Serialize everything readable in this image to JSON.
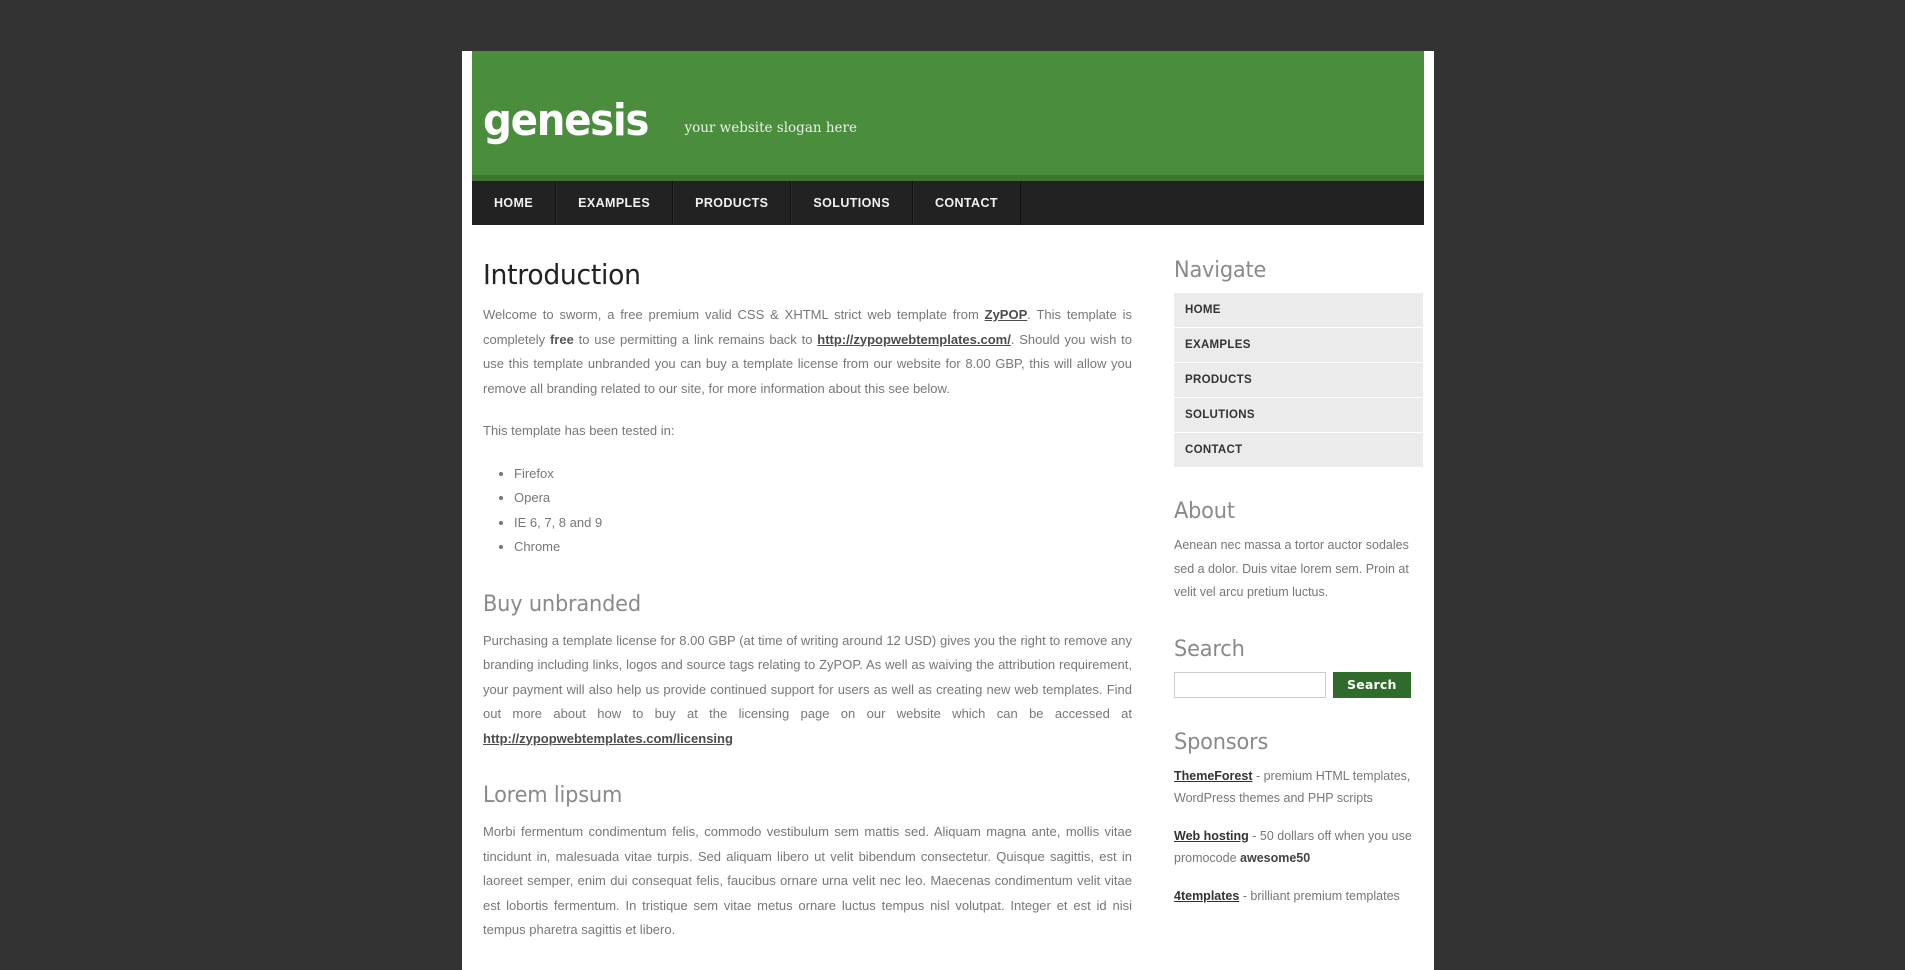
{
  "site": {
    "logo": "genesis",
    "slogan": "your website slogan here"
  },
  "main_nav": [
    {
      "label": "HOME"
    },
    {
      "label": "EXAMPLES"
    },
    {
      "label": "PRODUCTS"
    },
    {
      "label": "SOLUTIONS"
    },
    {
      "label": "CONTACT"
    }
  ],
  "main": {
    "page_title": "Introduction",
    "intro": {
      "part1": "Welcome to sworm, a free premium valid CSS & XHTML strict web template from ",
      "link1": "ZyPOP",
      "part2": ". This template is completely ",
      "bold1": "free",
      "part3": " to use permitting a link remains back to ",
      "link2": "http://zypopwebtemplates.com/",
      "part4": ". Should you wish to use this template unbranded you can buy a template license from our website for 8.00 GBP, this will allow you remove all branding related to our site, for more information about this see below."
    },
    "tested_intro": "This template has been tested in:",
    "browsers": [
      "Firefox",
      "Opera",
      "IE 6, 7, 8 and 9",
      "Chrome"
    ],
    "buy_heading": "Buy unbranded",
    "buy_text": {
      "part1": "Purchasing a template license for 8.00 GBP (at time of writing around 12 USD) gives you the right to remove any branding including links, logos and source tags relating to ZyPOP. As well as waiving the attribution requirement, your payment will also help us provide continued support for users as well as creating new web templates. Find out more about how to buy at the licensing page on our website which can be accessed at ",
      "link": "http://zypopwebtemplates.com/licensing"
    },
    "lorem_heading": "Lorem lipsum",
    "lorem_text": "Morbi fermentum condimentum felis, commodo vestibulum sem mattis sed. Aliquam magna ante, mollis vitae tincidunt in, malesuada vitae turpis. Sed aliquam libero ut velit bibendum consectetur. Quisque sagittis, est in laoreet semper, enim dui consequat felis, faucibus ornare urna velit nec leo. Maecenas condimentum velit vitae est lobortis fermentum. In tristique sem vitae metus ornare luctus tempus nisl volutpat. Integer et est id nisi tempus pharetra sagittis et libero."
  },
  "sidebar": {
    "navigate_heading": "Navigate",
    "nav_items": [
      {
        "label": "HOME"
      },
      {
        "label": "EXAMPLES"
      },
      {
        "label": "PRODUCTS"
      },
      {
        "label": "SOLUTIONS"
      },
      {
        "label": "CONTACT"
      }
    ],
    "about_heading": "About",
    "about_text": "Aenean nec massa a tortor auctor sodales sed a dolor. Duis vitae lorem sem. Proin at velit vel arcu pretium luctus.",
    "search_heading": "Search",
    "search_value": "",
    "search_placeholder": "",
    "search_button": "Search",
    "sponsors_heading": "Sponsors",
    "sponsors": [
      {
        "link": "ThemeForest",
        "desc_pre": " - premium HTML templates, WordPress themes and PHP scripts",
        "bold": "",
        "desc_post": ""
      },
      {
        "link": "Web hosting",
        "desc_pre": " - 50 dollars off when you use promocode ",
        "bold": "awesome50",
        "desc_post": ""
      },
      {
        "link": "4templates",
        "desc_pre": " - brilliant premium templates",
        "bold": "",
        "desc_post": ""
      }
    ]
  },
  "colors": {
    "brand_green": "#4a8d3d",
    "brand_green_dark": "#3d7633",
    "nav_dark": "#222222",
    "page_bg": "#333333",
    "sidebar_item_bg": "#ebebeb",
    "button_green": "#2f6b2a"
  }
}
